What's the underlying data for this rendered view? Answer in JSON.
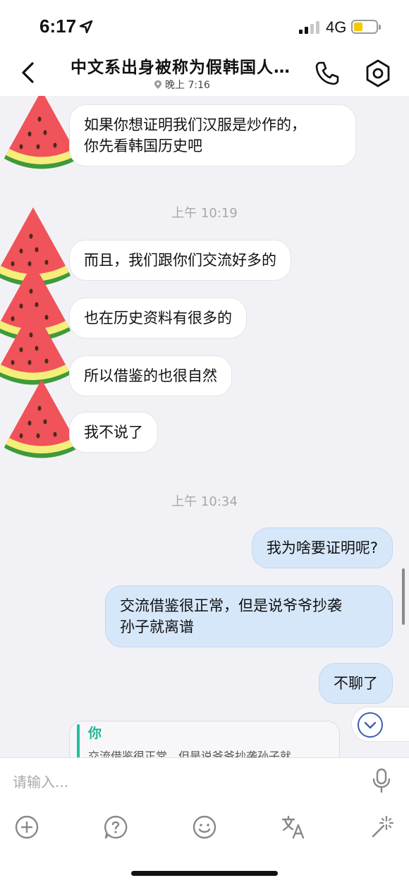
{
  "status_bar": {
    "time": "6:17",
    "network": "4G"
  },
  "header": {
    "title": "中文系出身被称为假韩国人…",
    "subtitle": "晚上 7:16"
  },
  "messages": [
    {
      "type": "in",
      "text": "如果你想证明我们汉服是炒作的，\n你先看韩国历史吧"
    },
    {
      "type": "timestamp",
      "text": "上午 10:19"
    },
    {
      "type": "in",
      "text": "而且，我们跟你们交流好多的"
    },
    {
      "type": "in",
      "text": "也在历史资料有很多的"
    },
    {
      "type": "in",
      "text": "所以借鉴的也很自然"
    },
    {
      "type": "in",
      "text": "我不说了"
    },
    {
      "type": "timestamp",
      "text": "上午 10:34"
    },
    {
      "type": "out",
      "text": "我为啥要证明呢?"
    },
    {
      "type": "out",
      "text": "交流借鉴很正常，但是说爷爷抄袭\n孙子就离谱"
    },
    {
      "type": "out",
      "text": "不聊了"
    }
  ],
  "reply_preview": {
    "sender": "你",
    "quote": "交流借鉴很正常，但是说爷爷抄袭孙子就"
  },
  "input": {
    "placeholder": "请输入..."
  },
  "toolbar": {
    "icons": [
      "add-icon",
      "help-icon",
      "emoji-icon",
      "translate-icon",
      "magic-icon"
    ]
  },
  "colors": {
    "outgoing_bubble": "#d7e7fa",
    "incoming_bubble": "#ffffff",
    "reply_accent": "#20c0a0",
    "background": "#f2f2f6"
  }
}
